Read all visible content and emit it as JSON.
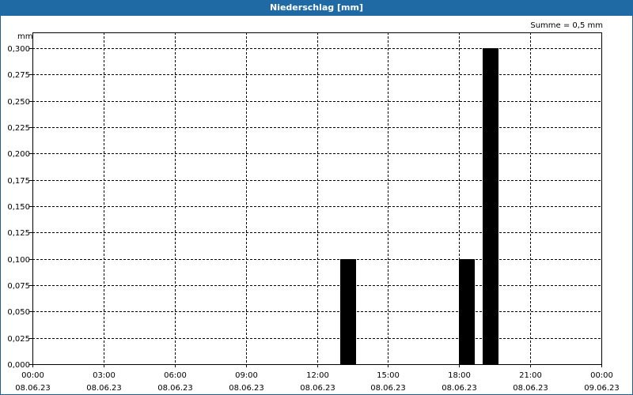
{
  "title": "Niederschlag [mm]",
  "summary": "Summe = 0,5 mm",
  "colors": {
    "title_bar": "#1f6aa5",
    "bars": "#000000",
    "grid": "#000000"
  },
  "chart_data": {
    "type": "bar",
    "title": "Niederschlag [mm]",
    "ylabel": "mm",
    "xlabel": "",
    "ylim": [
      0,
      0.3
    ],
    "xlim_hours": [
      0,
      24
    ],
    "grid": true,
    "ytick_labels": [
      "0,000",
      "0,025",
      "0,050",
      "0,075",
      "0,100",
      "0,125",
      "0,150",
      "0,175",
      "0,200",
      "0,225",
      "0,250",
      "0,275",
      "0,300"
    ],
    "xticks": [
      {
        "time": "00:00",
        "date": "08.06.23"
      },
      {
        "time": "03:00",
        "date": "08.06.23"
      },
      {
        "time": "06:00",
        "date": "08.06.23"
      },
      {
        "time": "09:00",
        "date": "08.06.23"
      },
      {
        "time": "12:00",
        "date": "08.06.23"
      },
      {
        "time": "15:00",
        "date": "08.06.23"
      },
      {
        "time": "18:00",
        "date": "08.06.23"
      },
      {
        "time": "21:00",
        "date": "08.06.23"
      },
      {
        "time": "00:00",
        "date": "09.06.23"
      }
    ],
    "bars": [
      {
        "start": "13:00",
        "end": "13:40",
        "value": 0.1
      },
      {
        "start": "18:00",
        "end": "18:40",
        "value": 0.1
      },
      {
        "start": "19:00",
        "end": "19:40",
        "value": 0.3
      }
    ]
  }
}
